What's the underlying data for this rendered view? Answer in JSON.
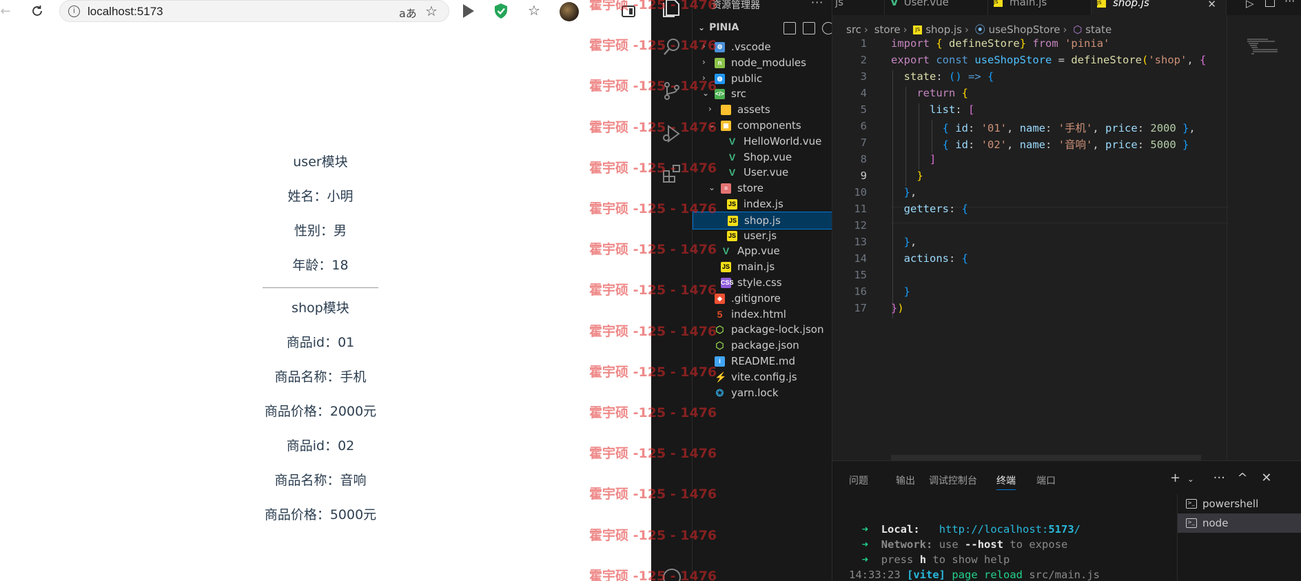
{
  "browser": {
    "url": "localhost:5173",
    "read_aloud_label": "aあ"
  },
  "page": {
    "user_title": "user模块",
    "user_name": "姓名：小明",
    "user_gender": "性别：男",
    "user_age": "年龄：18",
    "shop_title": "shop模块",
    "items": [
      {
        "id": "商品id：01",
        "name": "商品名称：手机",
        "price": "商品价格：2000元"
      },
      {
        "id": "商品id：02",
        "name": "商品名称：音响",
        "price": "商品价格：5000元"
      }
    ]
  },
  "watermark": "霍宇硕 -125 - 1476",
  "vscode": {
    "explorer_title": "资源管理器",
    "explorer_more": "···",
    "root": "PINIA",
    "tree": [
      {
        "label": ".vscode",
        "icon": "vscode-folder-icon"
      },
      {
        "label": "node_modules",
        "icon": "node-folder-icon"
      },
      {
        "label": "public",
        "icon": "public-folder-icon"
      },
      {
        "label": "src",
        "icon": "src-folder-icon"
      },
      {
        "label": "assets",
        "icon": "assets-folder-icon"
      },
      {
        "label": "components",
        "icon": "components-folder-icon"
      },
      {
        "label": "HelloWorld.vue",
        "icon": "vue-icon"
      },
      {
        "label": "Shop.vue",
        "icon": "vue-icon"
      },
      {
        "label": "User.vue",
        "icon": "vue-icon"
      },
      {
        "label": "store",
        "icon": "store-folder-icon"
      },
      {
        "label": "index.js",
        "icon": "js-icon"
      },
      {
        "label": "shop.js",
        "icon": "js-icon"
      },
      {
        "label": "user.js",
        "icon": "js-icon"
      },
      {
        "label": "App.vue",
        "icon": "vue-icon"
      },
      {
        "label": "main.js",
        "icon": "js-icon"
      },
      {
        "label": "style.css",
        "icon": "css-icon"
      },
      {
        "label": ".gitignore",
        "icon": "git-icon"
      },
      {
        "label": "index.html",
        "icon": "html-icon"
      },
      {
        "label": "package-lock.json",
        "icon": "node-json-icon"
      },
      {
        "label": "package.json",
        "icon": "node-json-icon"
      },
      {
        "label": "README.md",
        "icon": "info-icon"
      },
      {
        "label": "vite.config.js",
        "icon": "vite-icon"
      },
      {
        "label": "yarn.lock",
        "icon": "yarn-icon"
      }
    ],
    "tabs": [
      {
        "label": "js"
      },
      {
        "label": "User.vue"
      },
      {
        "label": "main.js"
      },
      {
        "label": "shop.js"
      }
    ],
    "breadcrumb": [
      "src",
      "store",
      "shop.js",
      "useShopStore",
      "state"
    ],
    "line_numbers": [
      "1",
      "2",
      "3",
      "4",
      "5",
      "6",
      "7",
      "8",
      "9",
      "10",
      "11",
      "12",
      "13",
      "14",
      "15",
      "16",
      "17"
    ],
    "code": {
      "import": "import",
      "defineStore": "defineStore",
      "from": "from",
      "pinia_str": "'pinia'",
      "export": "export",
      "const": "const",
      "useShopStore": "useShopStore",
      "shop_str": "'shop'",
      "state": "state",
      "return": "return",
      "list": "list",
      "id": "id",
      "name": "name",
      "price": "price",
      "id1": "'01'",
      "name1": "'手机'",
      "price1": "2000",
      "id2": "'02'",
      "name2": "'音响'",
      "price2": "5000",
      "getters": "getters",
      "actions": "actions"
    },
    "panel_tabs": [
      "问题",
      "输出",
      "调试控制台",
      "终端",
      "端口"
    ],
    "terminal": {
      "local_label": "Local:",
      "local_url_pre": "http://localhost:",
      "local_port": "5173",
      "local_url_post": "/",
      "network_label": "Network:",
      "network_use": "use",
      "network_flag": "--host",
      "network_post": "to expose",
      "help_pre": "press",
      "help_key": "h",
      "help_post": "to show help",
      "log_time": "14:33:23",
      "log_tag": "[vite]",
      "log_msg": "page reload",
      "log_file": "src/main.js"
    },
    "terminal_list": [
      "powershell",
      "node"
    ]
  }
}
